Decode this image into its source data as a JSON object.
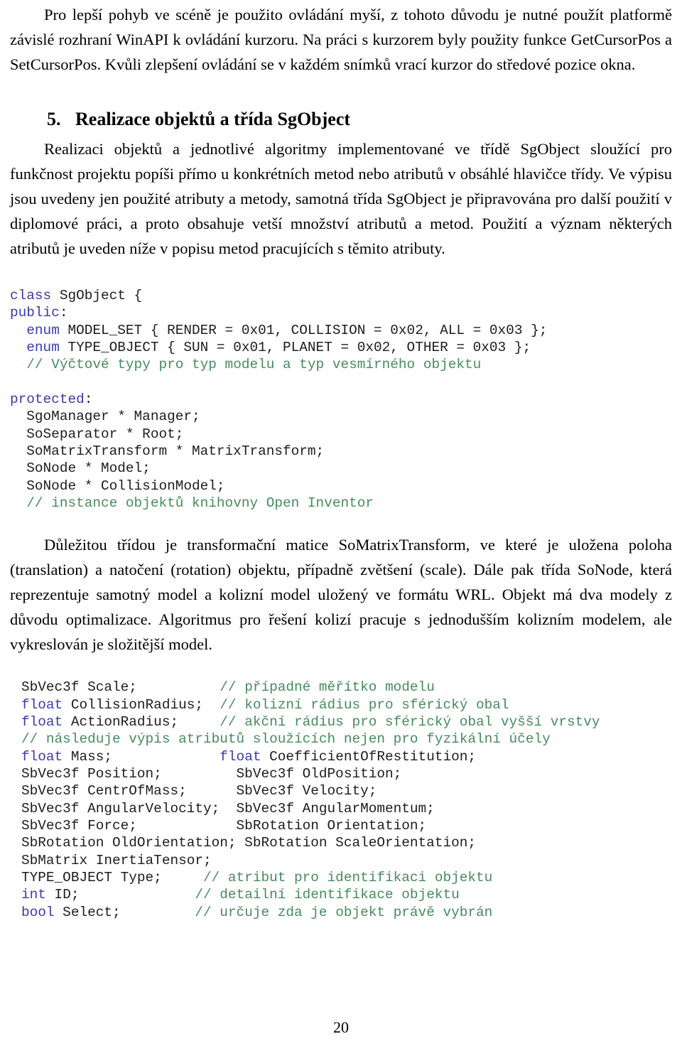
{
  "document": {
    "page_number": "20",
    "language": "cs"
  },
  "paragraphs": {
    "intro": "Pro lepší pohyb ve scéně je použito ovládání myší, z tohoto důvodu je nutné použít platformě závislé rozhraní WinAPI k ovládání kurzoru. Na práci s kurzorem byly použity funkce GetCursorPos a SetCursorPos. Kvůli zlepšení ovládání se v každém snímků vrací kurzor do středové pozice okna.",
    "after_heading": "Realizaci objektů a jednotlivé algoritmy implementované ve třídě SgObject sloužící pro funkčnost projektu popíši přímo u konkrétních metod nebo atributů v obsáhlé hlavičce třídy. Ve výpisu jsou uvedeny jen použité atributy a metody, samotná třída SgObject je připravována pro další použití v diplomové práci, a proto obsahuje vetší množství atributů a metod. Použití a význam některých atributů je uveden níže v popisu metod pracujících s těmito atributy.",
    "between_code": "Důležitou třídou je transformační matice SoMatrixTransform, ve které je uložena poloha (translation) a natočení (rotation) objektu, případně zvětšení (scale). Dále pak třída SoNode, která reprezentuje samotný model a kolizní model uložený ve formátu WRL. Objekt má dva modely z důvodu optimalizace. Algoritmus pro řešení kolizí pracuje s jednodušším kolizním modelem, ale vykreslován je složitější model."
  },
  "heading": {
    "number": "5.",
    "text": "Realizace objektů a třída SgObject"
  },
  "colors": {
    "keyword": "#3b3bad",
    "comment": "#468c5e",
    "plain": "#1d1d1d",
    "text": "#000000",
    "background": "#ffffff"
  },
  "code_block_1": {
    "lines": [
      [
        {
          "t": "class",
          "c": "kw"
        },
        {
          "t": " SgObject {",
          "c": "pln"
        }
      ],
      [
        {
          "t": "public",
          "c": "kw"
        },
        {
          "t": ":",
          "c": "pln"
        }
      ],
      [
        {
          "t": "  ",
          "c": "pln"
        },
        {
          "t": "enum",
          "c": "kw"
        },
        {
          "t": " MODEL_SET { RENDER = 0x01, COLLISION = 0x02, ALL = 0x03 };",
          "c": "pln"
        }
      ],
      [
        {
          "t": "  ",
          "c": "pln"
        },
        {
          "t": "enum",
          "c": "kw"
        },
        {
          "t": " TYPE_OBJECT { SUN = 0x01, PLANET = 0x02, OTHER = 0x03 };",
          "c": "pln"
        }
      ],
      [
        {
          "t": "  ",
          "c": "pln"
        },
        {
          "t": "// Výčtové typy pro typ modelu a typ vesmírného objektu",
          "c": "cmt"
        }
      ],
      [
        {
          "t": "",
          "c": "pln"
        }
      ],
      [
        {
          "t": "protected",
          "c": "kw"
        },
        {
          "t": ":",
          "c": "pln"
        }
      ],
      [
        {
          "t": "  SgoManager * Manager;",
          "c": "pln"
        }
      ],
      [
        {
          "t": "  SoSeparator * Root;",
          "c": "pln"
        }
      ],
      [
        {
          "t": "  SoMatrixTransform * MatrixTransform;",
          "c": "pln"
        }
      ],
      [
        {
          "t": "  SoNode * Model;",
          "c": "pln"
        }
      ],
      [
        {
          "t": "  SoNode * CollisionModel;",
          "c": "pln"
        }
      ],
      [
        {
          "t": "  ",
          "c": "pln"
        },
        {
          "t": "// instance objektů knihovny Open Inventor",
          "c": "cmt"
        }
      ]
    ]
  },
  "code_block_2": {
    "lines": [
      [
        {
          "t": "SbVec3f Scale;          ",
          "c": "pln"
        },
        {
          "t": "// případné měřítko modelu",
          "c": "cmt"
        }
      ],
      [
        {
          "t": "float",
          "c": "kw"
        },
        {
          "t": " CollisionRadius;  ",
          "c": "pln"
        },
        {
          "t": "// kolizní rádius pro sférický obal",
          "c": "cmt"
        }
      ],
      [
        {
          "t": "float",
          "c": "kw"
        },
        {
          "t": " ActionRadius;     ",
          "c": "pln"
        },
        {
          "t": "// akční rádius pro sférický obal vyšší vrstvy",
          "c": "cmt"
        }
      ],
      [
        {
          "t": "// následuje výpis atributů sloužících nejen pro fyzikální účely",
          "c": "cmt"
        }
      ],
      [
        {
          "t": "float",
          "c": "kw"
        },
        {
          "t": " Mass;             ",
          "c": "pln"
        },
        {
          "t": "float",
          "c": "kw"
        },
        {
          "t": " CoefficientOfRestitution;",
          "c": "pln"
        }
      ],
      [
        {
          "t": "SbVec3f Position;         SbVec3f OldPosition;",
          "c": "pln"
        }
      ],
      [
        {
          "t": "SbVec3f CentrOfMass;      SbVec3f Velocity;",
          "c": "pln"
        }
      ],
      [
        {
          "t": "SbVec3f AngularVelocity;  SbVec3f AngularMomentum;",
          "c": "pln"
        }
      ],
      [
        {
          "t": "SbVec3f Force;            SbRotation Orientation;",
          "c": "pln"
        }
      ],
      [
        {
          "t": "SbRotation OldOrientation; SbRotation ScaleOrientation;",
          "c": "pln"
        }
      ],
      [
        {
          "t": "SbMatrix InertiaTensor;",
          "c": "pln"
        }
      ],
      [
        {
          "t": "TYPE_OBJECT Type;     ",
          "c": "pln"
        },
        {
          "t": "// atribut pro identifikaci objektu",
          "c": "cmt"
        }
      ],
      [
        {
          "t": "int",
          "c": "kw"
        },
        {
          "t": " ID;              ",
          "c": "pln"
        },
        {
          "t": "// detailní identifikace objektu",
          "c": "cmt"
        }
      ],
      [
        {
          "t": "bool",
          "c": "kw"
        },
        {
          "t": " Select;         ",
          "c": "pln"
        },
        {
          "t": "// určuje zda je objekt právě vybrán",
          "c": "cmt"
        }
      ]
    ]
  }
}
